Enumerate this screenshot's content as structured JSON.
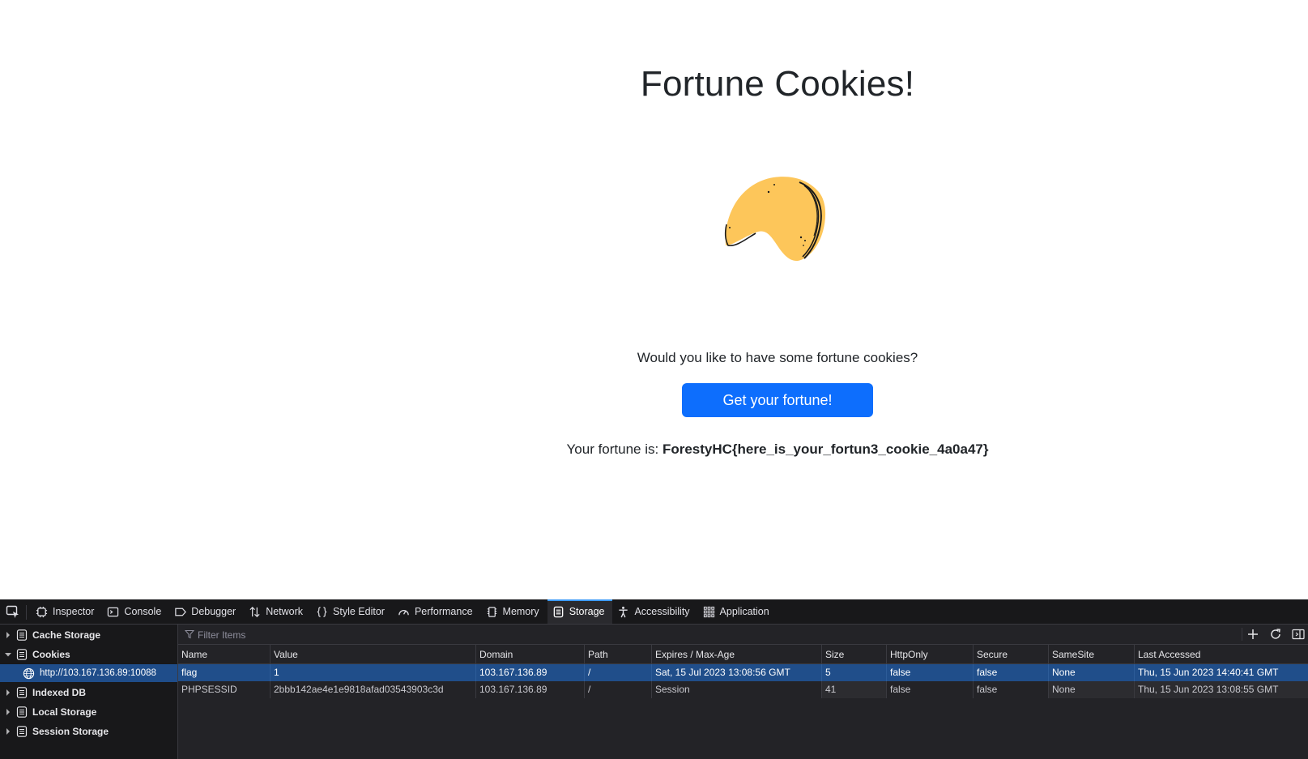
{
  "page": {
    "title": "Fortune Cookies!",
    "question": "Would you like to have some fortune cookies?",
    "button_label": "Get your fortune!",
    "fortune_prefix": "Your fortune is: ",
    "fortune_value": "ForestyHC{here_is_your_fortun3_cookie_4a0a47}",
    "cookie_color": "#fdc65a",
    "button_color": "#0d6efd"
  },
  "devtools": {
    "tabs": [
      {
        "label": "Inspector",
        "icon": "inspector-icon"
      },
      {
        "label": "Console",
        "icon": "console-icon"
      },
      {
        "label": "Debugger",
        "icon": "debugger-icon"
      },
      {
        "label": "Network",
        "icon": "network-icon"
      },
      {
        "label": "Style Editor",
        "icon": "style-editor-icon"
      },
      {
        "label": "Performance",
        "icon": "performance-icon"
      },
      {
        "label": "Memory",
        "icon": "memory-icon"
      },
      {
        "label": "Storage",
        "icon": "storage-icon",
        "active": true
      },
      {
        "label": "Accessibility",
        "icon": "accessibility-icon"
      },
      {
        "label": "Application",
        "icon": "application-icon"
      }
    ],
    "sidebar": {
      "items": [
        {
          "label": "Cache Storage",
          "expanded": false
        },
        {
          "label": "Cookies",
          "expanded": true
        },
        {
          "label": "http://103.167.136.89:10088",
          "child": true,
          "selected": true
        },
        {
          "label": "Indexed DB",
          "expanded": false
        },
        {
          "label": "Local Storage",
          "expanded": false
        },
        {
          "label": "Session Storage",
          "expanded": false
        }
      ]
    },
    "filter": {
      "placeholder": "Filter Items"
    },
    "columns": [
      "Name",
      "Value",
      "Domain",
      "Path",
      "Expires / Max-Age",
      "Size",
      "HttpOnly",
      "Secure",
      "SameSite",
      "Last Accessed"
    ],
    "rows": [
      [
        "flag",
        "1",
        "103.167.136.89",
        "/",
        "Sat, 15 Jul 2023 13:08:56 GMT",
        "5",
        "false",
        "false",
        "None",
        "Thu, 15 Jun 2023 14:40:41 GMT"
      ],
      [
        "PHPSESSID",
        "2bbb142ae4e1e9818afad03543903c3d",
        "103.167.136.89",
        "/",
        "Session",
        "41",
        "false",
        "false",
        "None",
        "Thu, 15 Jun 2023 13:08:55 GMT"
      ]
    ],
    "accent_color": "#3c9af8",
    "selection_color": "#204e8a"
  }
}
